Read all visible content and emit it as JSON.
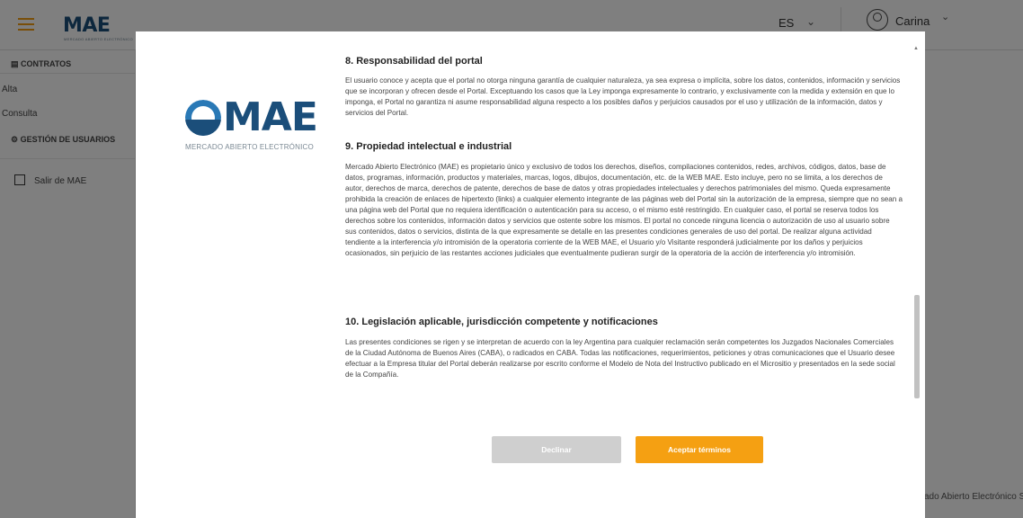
{
  "topbar": {
    "logo": "MAE",
    "logo_sub": "MERCADO ABIERTO ELECTRÓNICO",
    "language": "ES",
    "user_name": "Carina"
  },
  "sidebar": {
    "section_contracts": "CONTRATOS",
    "item_alta": "Alta",
    "item_consulta": "Consulta",
    "section_users": "GESTIÓN DE USUARIOS",
    "exit_label": "Salir de MAE"
  },
  "footer": {
    "text": "ado Abierto Electrónico S"
  },
  "modal": {
    "logo_text": "MAE",
    "logo_sub": "MERCADO ABIERTO ELECTRÓNICO",
    "sections": [
      {
        "heading": "8. Responsabilidad del portal",
        "body": "El usuario conoce y acepta que el portal no otorga ninguna garantía de cualquier naturaleza, ya sea expresa o implícita, sobre los datos, contenidos, información y servicios que se incorporan y ofrecen desde el Portal. Exceptuando los casos que la Ley imponga expresamente lo contrario, y exclusivamente con la medida y extensión en que lo imponga, el Portal no garantiza ni asume responsabilidad alguna respecto a los posibles daños y perjuicios causados por el uso y utilización de la información, datos y servicios del Portal."
      },
      {
        "heading": "9. Propiedad intelectual e industrial",
        "body": "Mercado Abierto Electrónico (MAE) es propietario único y exclusivo de todos los derechos, diseños, compilaciones contenidos, redes, archivos, códigos, datos, base de datos, programas, información, productos y materiales, marcas, logos, dibujos, documentación, etc. de la WEB MAE. Esto incluye, pero no se limita, a los derechos de autor, derechos de marca, derechos de patente, derechos de base de datos y otras propiedades intelectuales y derechos patrimoniales del mismo. Queda expresamente prohibida la creación de enlaces de hipertexto (links) a cualquier elemento integrante de las páginas web del Portal sin la autorización de la empresa, siempre que no sean a una página web del Portal que no requiera identificación o autenticación para su acceso, o el mismo esté restringido. En cualquier caso, el portal se reserva todos los derechos sobre los contenidos, información datos y servicios que ostente sobre los mismos. El portal no concede ninguna licencia o autorización de uso al usuario sobre sus contenidos, datos o servicios, distinta de la que expresamente se detalle en las presentes condiciones generales de uso del portal. De realizar alguna actividad tendiente a la interferencia y/o intromisión de la operatoria corriente de la WEB MAE, el Usuario y/o Visitante responderá judicialmente por los daños y perjuicios ocasionados, sin perjuicio de las restantes acciones judiciales que eventualmente pudieran surgir de la operatoria de la acción de interferencia y/o intromisión."
      },
      {
        "heading": "10. Legislación aplicable, jurisdicción competente y notificaciones",
        "body": "Las presentes condiciones se rigen y se interpretan de acuerdo con la ley Argentina para cualquier reclamación serán competentes los Juzgados Nacionales Comerciales de la Ciudad Autónoma de Buenos Aires (CABA), o radicados en CABA. Todas las notificaciones, requerimientos, peticiones y otras comunicaciones que el Usuario desee efectuar a la Empresa titular del Portal deberán realizarse por escrito conforme el Modelo de Nota del Instructivo publicado en el Micrositio y presentados en la sede social de la Compañía."
      }
    ],
    "decline_label": "Declinar",
    "accept_label": "Aceptar términos"
  }
}
